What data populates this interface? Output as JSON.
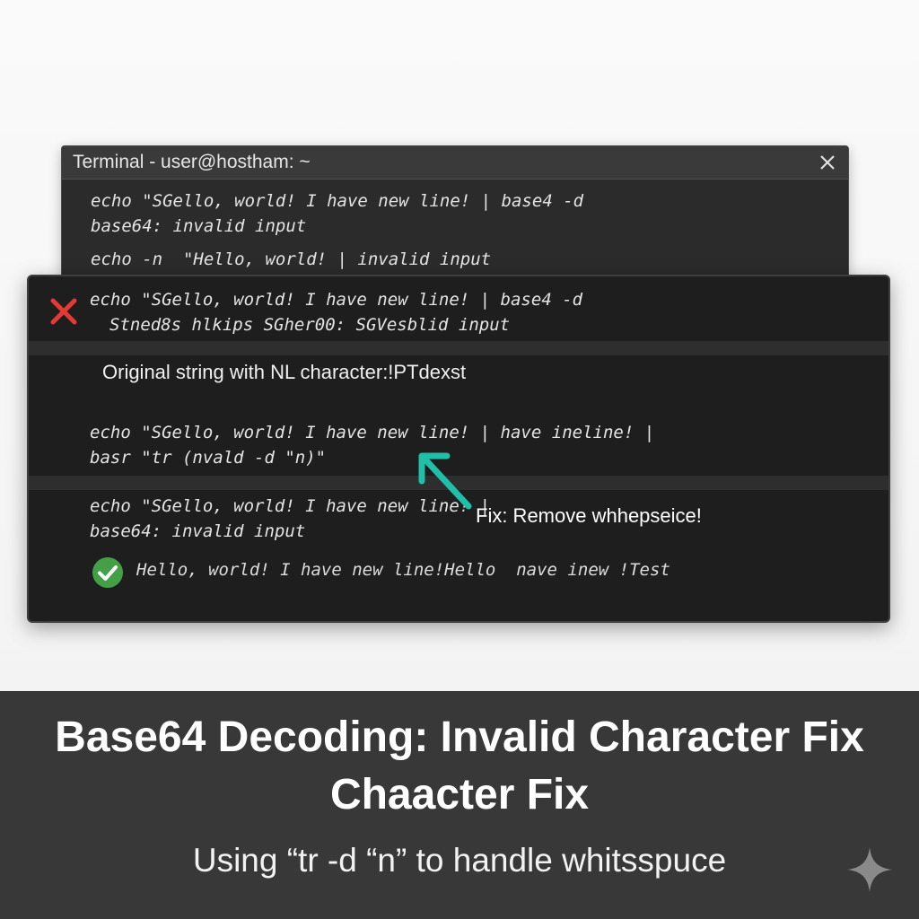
{
  "window": {
    "title": "Terminal - user@hostham: ~"
  },
  "back_terminal": {
    "lines": [
      "echo \"SGello, world! I have new line! | base4 -d",
      "base64: invalid input",
      "echo -n  \"Hello, world! | invalid input"
    ]
  },
  "front_terminal": {
    "error_block": {
      "line1": "echo \"SGello, world! I have new line! | base4 -d",
      "line2": "Stned8s hlkips SGher00: SGVesblid input"
    },
    "original_label": "Original string with NL character:!PTdexst",
    "command2": {
      "line1": "echo \"SGello, world! I have new line! | have ineline! |",
      "line2": "basr \"tr (nvald -d \"n)\""
    },
    "command3": {
      "line1": "echo \"SGello, world! I have new line! |",
      "line2": "base64: invalid input"
    },
    "fix_annotation": "Fix: Remove whhepseice!",
    "success_output": "Hello, world! I have new line!Hello  nave inew !Test"
  },
  "banner": {
    "title_line1": "Base64 Decoding: Invalid Character Fix",
    "title_line2": "Chaacter Fix",
    "subtitle": "Using “tr -d “n” to handle whitsspuce"
  },
  "icons": {
    "close": "close-icon",
    "error": "x-mark-icon",
    "success": "check-circle-icon",
    "arrow": "arrow-icon",
    "sparkle": "sparkle-icon"
  },
  "colors": {
    "error_red": "#e53935",
    "success_green": "#43a047",
    "arrow_teal": "#1fbfa8",
    "banner_bg": "#383838",
    "terminal_bg": "#1e1e1e"
  }
}
